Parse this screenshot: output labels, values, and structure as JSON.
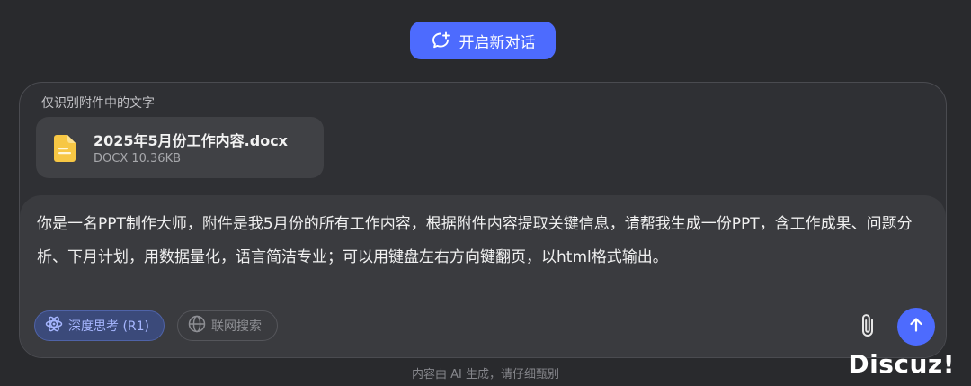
{
  "header": {
    "new_chat_label": "开启新对话"
  },
  "composer": {
    "attachment_note": "仅识别附件中的文字",
    "file": {
      "name": "2025年5月份工作内容.docx",
      "meta": "DOCX 10.36KB",
      "icon": "document-icon",
      "icon_color": "#f7c744"
    },
    "prompt": "你是一名PPT制作大师，附件是我5月份的所有工作内容，根据附件内容提取关键信息，请帮我生成一份PPT，含工作成果、问题分析、下月计划，用数据量化，语言简洁专业；可以用键盘左右方向键翻页，以html格式输出。",
    "deep_think_label": "深度思考 (R1)",
    "web_search_label": "联网搜索",
    "accent_color": "#4d6bfe"
  },
  "footer": {
    "disclaimer": "内容由 AI 生成，请仔细甄别"
  },
  "watermark": {
    "text": "Discuz!"
  }
}
